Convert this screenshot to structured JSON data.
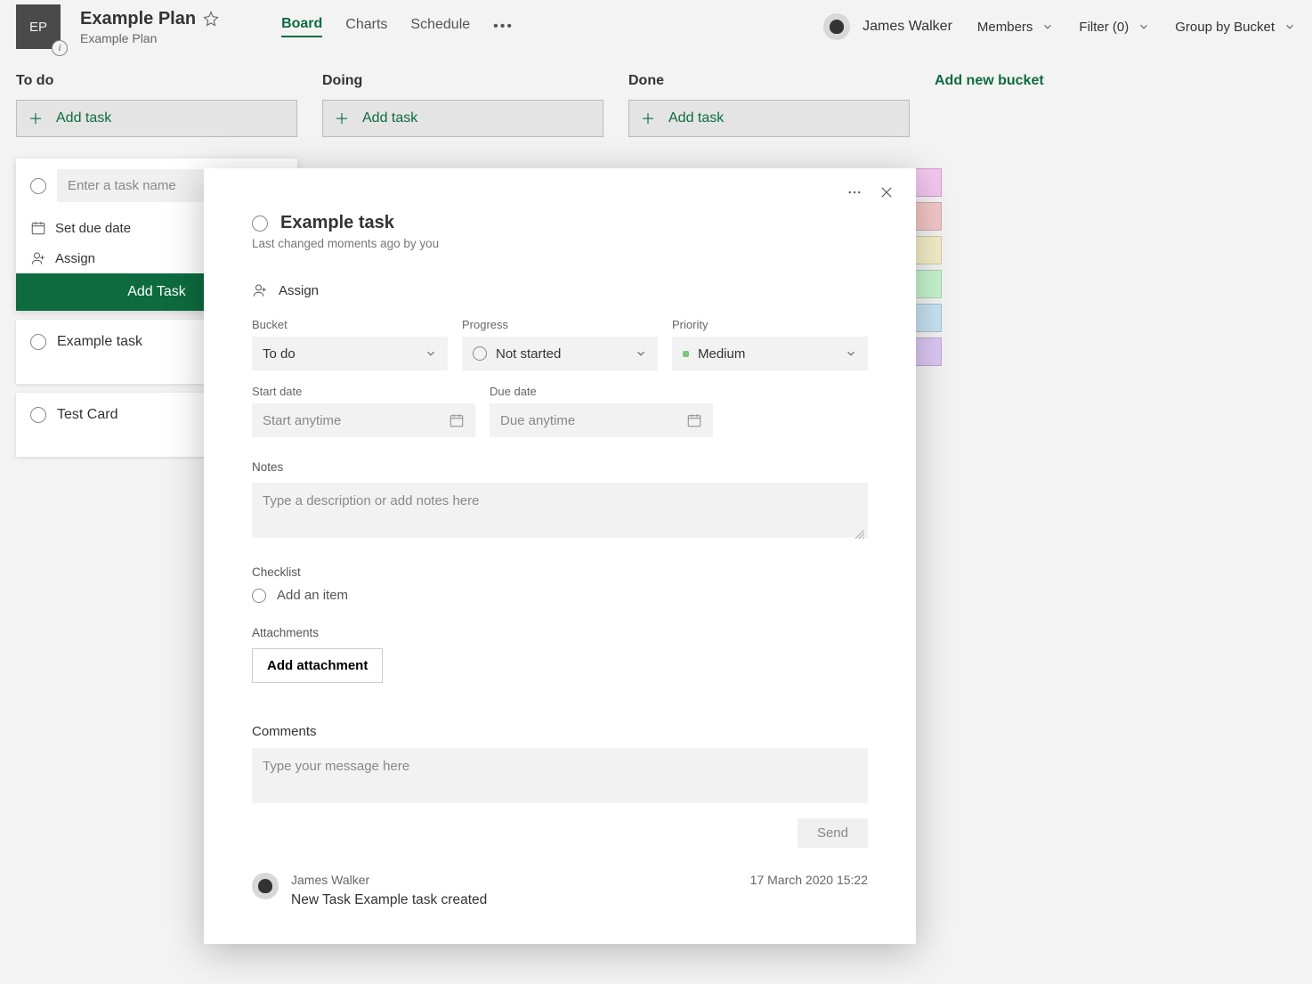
{
  "header": {
    "plan_initials": "EP",
    "plan_title": "Example Plan",
    "plan_subtitle": "Example Plan",
    "tabs": [
      "Board",
      "Charts",
      "Schedule"
    ],
    "active_tab": "Board",
    "user_name": "James Walker",
    "members_label": "Members",
    "filter_label": "Filter (0)",
    "group_label": "Group by Bucket"
  },
  "board": {
    "buckets": [
      {
        "title": "To do",
        "add_label": "Add task"
      },
      {
        "title": "Doing",
        "add_label": "Add task"
      },
      {
        "title": "Done",
        "add_label": "Add task"
      }
    ],
    "add_bucket_label": "Add new bucket",
    "new_task": {
      "name_placeholder": "Enter a task name",
      "due_label": "Set due date",
      "assign_label": "Assign",
      "add_button": "Add Task"
    },
    "existing_tasks": [
      "Example task",
      "Test Card"
    ]
  },
  "modal": {
    "title": "Example task",
    "subtitle": "Last changed moments ago by you",
    "assign_label": "Assign",
    "bucket": {
      "label": "Bucket",
      "value": "To do"
    },
    "progress": {
      "label": "Progress",
      "value": "Not started"
    },
    "priority": {
      "label": "Priority",
      "value": "Medium"
    },
    "start_date": {
      "label": "Start date",
      "placeholder": "Start anytime"
    },
    "due_date": {
      "label": "Due date",
      "placeholder": "Due anytime"
    },
    "notes": {
      "label": "Notes",
      "placeholder": "Type a description or add notes here"
    },
    "checklist": {
      "label": "Checklist",
      "add_item": "Add an item"
    },
    "attachments": {
      "label": "Attachments",
      "button": "Add attachment"
    },
    "comments": {
      "label": "Comments",
      "placeholder": "Type your message here",
      "send": "Send",
      "items": [
        {
          "author": "James Walker",
          "time": "17 March 2020 15:22",
          "body": "New Task Example task created"
        }
      ]
    }
  },
  "label_colors": [
    "#f3c6ef",
    "#f3c6c6",
    "#f3eec6",
    "#c6f3cf",
    "#c6e2f3",
    "#dcc6f3"
  ]
}
